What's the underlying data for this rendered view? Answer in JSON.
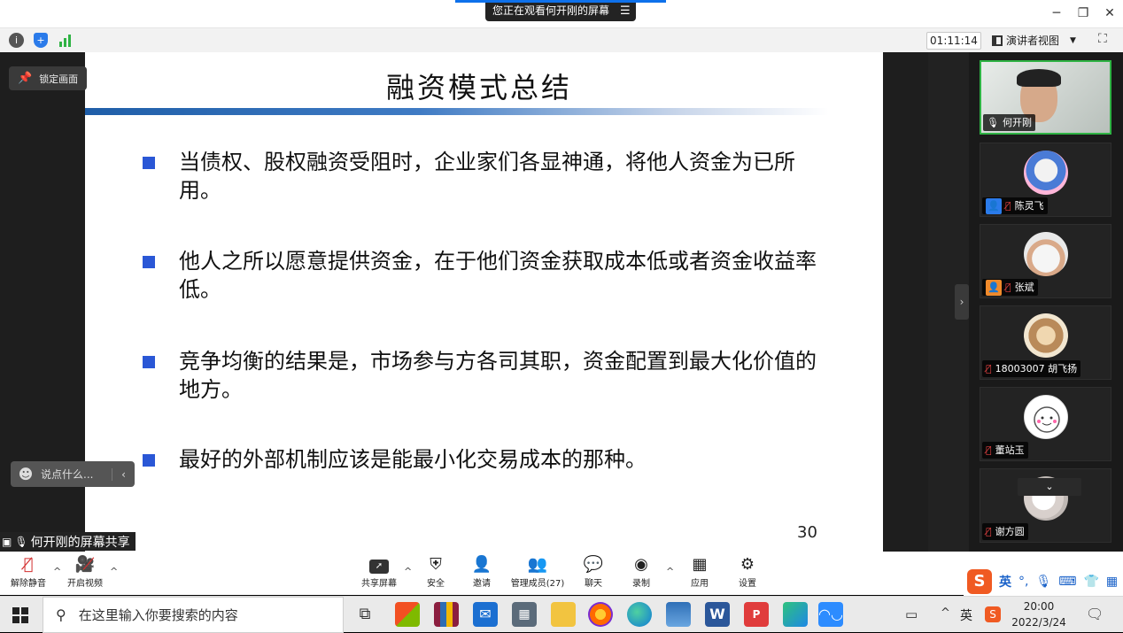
{
  "window": {
    "share_pill_label": "您正在观看何开刚的屏幕",
    "minimize_icon": "minimize-icon",
    "restore_icon": "restore-icon",
    "close_icon": "close-icon"
  },
  "toolbar": {
    "timer": "01:11:14",
    "view_label": "演讲者视图"
  },
  "share": {
    "lock_label": "锁定画面",
    "chat_placeholder": "说点什么...",
    "sharer_label": "何开刚的屏幕共享"
  },
  "slide": {
    "title": "融资模式总结",
    "bullets": [
      "当债权、股权融资受阻时，企业家们各显神通，将他人资金为已所用。",
      "他人之所以愿意提供资金，在于他们资金获取成本低或者资金收益率低。",
      "竞争均衡的结果是，市场参与方各司其职，资金配置到最大化价值的地方。",
      "最好的外部机制应该是能最小化交易成本的那种。"
    ],
    "page_number": "30"
  },
  "participants": [
    {
      "name": "何开刚"
    },
    {
      "name": "陈灵飞"
    },
    {
      "name": "张斌"
    },
    {
      "name": "18003007 胡飞扬"
    },
    {
      "name": "董站玉"
    },
    {
      "name": "谢方圆"
    }
  ],
  "bottom_toolbar": {
    "unmute": "解除静音",
    "start_video": "开启视频",
    "share_screen": "共享屏幕",
    "security": "安全",
    "invite": "邀请",
    "manage_participants": "管理成员(27)",
    "chat": "聊天",
    "record": "录制",
    "apps": "应用",
    "settings": "设置"
  },
  "ime": {
    "mode": "英"
  },
  "taskbar": {
    "search_placeholder": "在这里输入你要搜索的内容",
    "lang": "英",
    "time": "20:00",
    "date": "2022/3/24"
  },
  "colors": {
    "accent": "#0e71eb",
    "bullet": "#2a57d6",
    "mic_off": "#e04040"
  }
}
